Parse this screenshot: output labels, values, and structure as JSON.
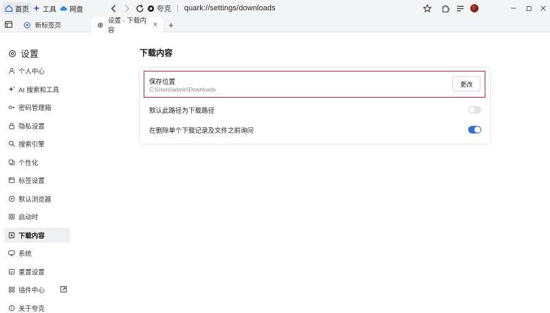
{
  "browser": {
    "nav": {
      "home_label": "首页",
      "tools_label": "工具",
      "drive_label": "网盘"
    },
    "address": {
      "site_label": "夸克",
      "url": "quark://settings/downloads"
    },
    "tabs": [
      {
        "label": "新标签页",
        "icon": "new-tab-icon"
      },
      {
        "label": "设置 - 下载内容",
        "icon": "gear-icon"
      }
    ],
    "new_tab_glyph": "+",
    "close_glyph": "×"
  },
  "sidebar": {
    "title": "设置",
    "items": [
      {
        "label": "个人中心",
        "icon": "user-icon"
      },
      {
        "label": "AI 搜索和工具",
        "icon": "ai-spark-icon"
      },
      {
        "label": "密码管理箱",
        "icon": "key-icon"
      },
      {
        "label": "隐私设置",
        "icon": "lock-icon"
      },
      {
        "label": "搜索引擎",
        "icon": "search-icon"
      },
      {
        "label": "个性化",
        "icon": "palette-icon"
      },
      {
        "label": "标签设置",
        "icon": "tab-icon"
      },
      {
        "label": "默认浏览器",
        "icon": "compass-icon"
      },
      {
        "label": "启动时",
        "icon": "startup-icon"
      },
      {
        "label": "下载内容",
        "icon": "download-icon",
        "active": true
      },
      {
        "label": "系统",
        "icon": "monitor-icon"
      },
      {
        "label": "重置设置",
        "icon": "reset-icon"
      },
      {
        "label": "插件中心",
        "icon": "puzzle-icon"
      },
      {
        "label": "关于夸克",
        "icon": "info-icon"
      }
    ]
  },
  "main": {
    "title": "下载内容",
    "save_location": {
      "label": "保存位置",
      "path": "C:\\Users\\admin\\Downloads",
      "button_label": "更改"
    },
    "options": [
      {
        "label": "默认此路径为下载路径",
        "enabled": false
      },
      {
        "label": "在删除单个下载记录及文件之前询问",
        "enabled": true
      }
    ]
  },
  "colors": {
    "accent": "#2f6fe4",
    "highlight_border": "#e0202b"
  }
}
